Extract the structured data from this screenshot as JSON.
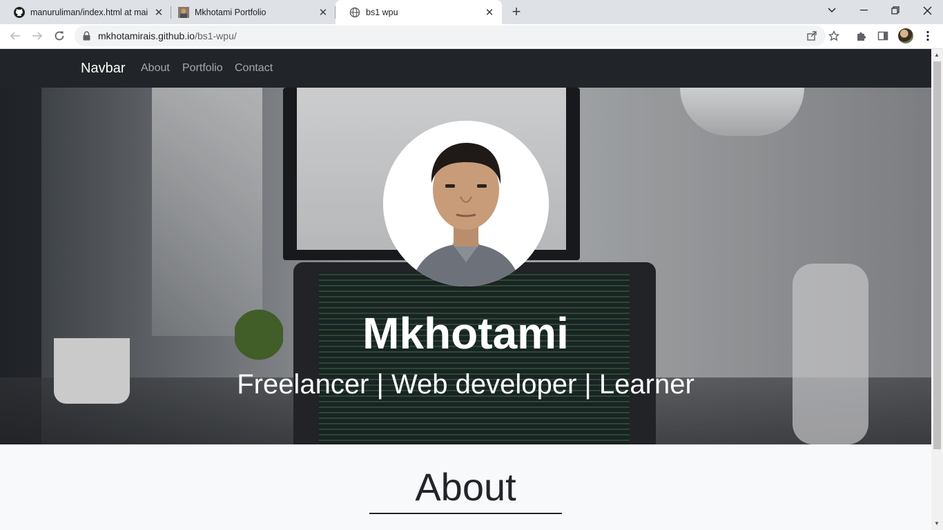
{
  "browser": {
    "tabs": [
      {
        "title": "manuruliman/index.html at main",
        "favicon": "github-icon",
        "active": false
      },
      {
        "title": "Mkhotami Portfolio",
        "favicon": "portrait-favicon",
        "active": false
      },
      {
        "title": "bs1 wpu",
        "favicon": "globe-icon",
        "active": true
      }
    ],
    "address": {
      "host": "mkhotamirais.github.io",
      "path": "/bs1-wpu/"
    }
  },
  "site": {
    "brand": "Navbar",
    "nav": [
      "About",
      "Portfolio",
      "Contact"
    ],
    "hero": {
      "name": "Mkhotami",
      "tagline": "Freelancer | Web developer | Learner"
    },
    "about": {
      "title": "About"
    }
  },
  "colors": {
    "navbar_bg": "#212529",
    "chrome_tabstrip": "#dee1e6",
    "page_bg": "#f8f9fa",
    "text_dark": "#212529"
  }
}
